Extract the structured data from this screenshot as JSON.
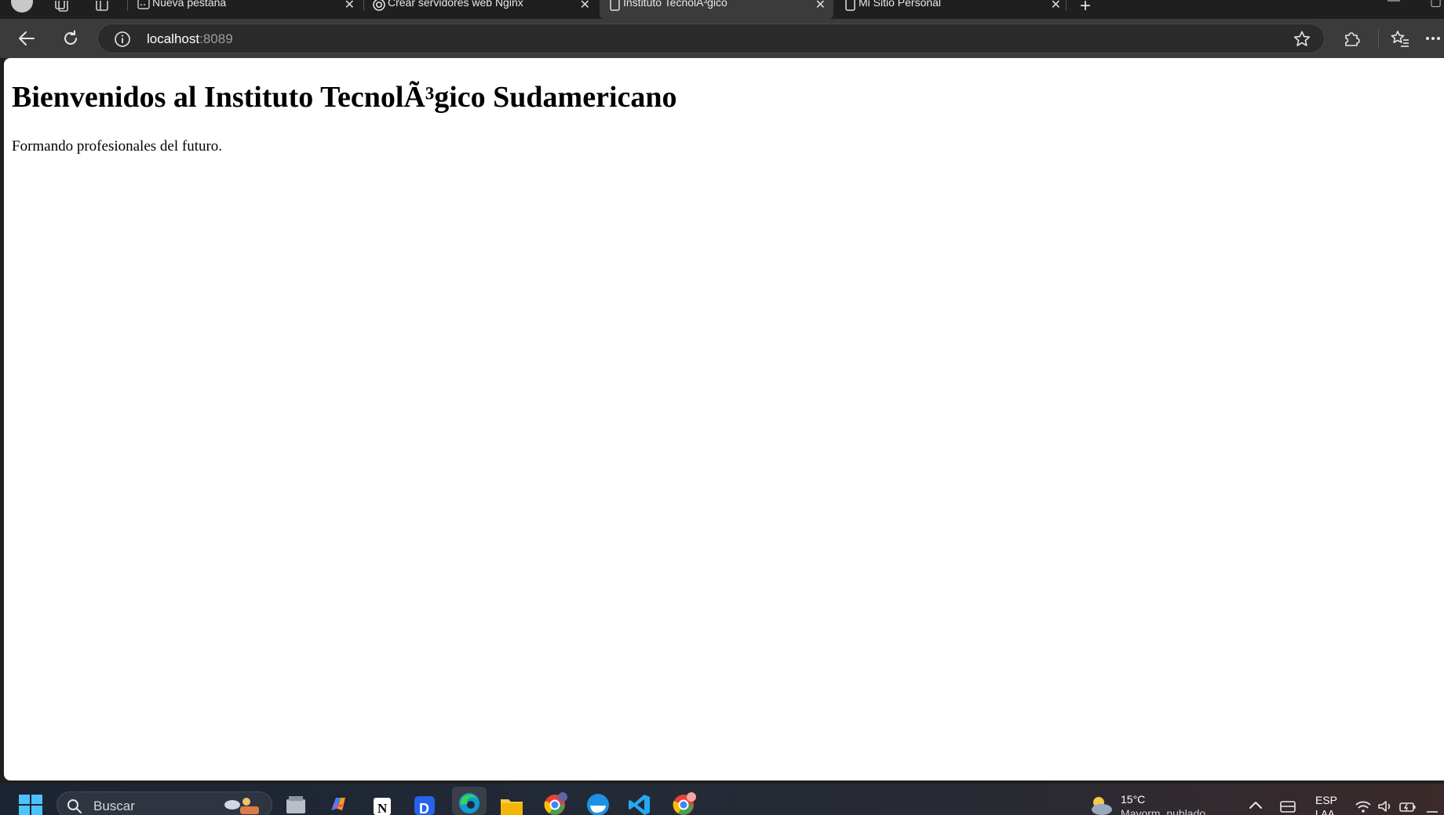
{
  "browser": {
    "tabs": [
      {
        "title": "Nueva pestaña",
        "active": false,
        "favicon": "new-tab-icon"
      },
      {
        "title": "Crear servidores web Nginx",
        "active": false,
        "favicon": "openai-icon"
      },
      {
        "title": "Instituto TecnolÃ³gico",
        "active": true,
        "favicon": "page-icon"
      },
      {
        "title": "Mi Sitio Personal",
        "active": false,
        "favicon": "page-icon"
      }
    ],
    "new_tab_label": "+",
    "close_glyph": "✕",
    "address": {
      "host": "localhost",
      "port": ":8089"
    }
  },
  "page": {
    "heading": "Bienvenidos al Instituto TecnolÃ³gico Sudamericano",
    "paragraph": "Formando profesionales del futuro."
  },
  "taskbar": {
    "search_label": "Buscar",
    "weather_temp": "15°C",
    "weather_desc": "Mayorm. nublado",
    "lang_top": "ESP",
    "lang_bottom": "LAA",
    "apps": [
      "file-explorer-icon",
      "copilot-icon",
      "notion-icon",
      "d-app-icon",
      "edge-icon",
      "folder-icon",
      "chrome-icon",
      "docker-icon",
      "vscode-icon",
      "chrome-profile-icon"
    ]
  },
  "colors": {
    "tabstrip": "#1f1f1f",
    "toolbar": "#3b3b3b",
    "omnibox": "#2b2b2b",
    "page_bg": "#ffffff"
  }
}
